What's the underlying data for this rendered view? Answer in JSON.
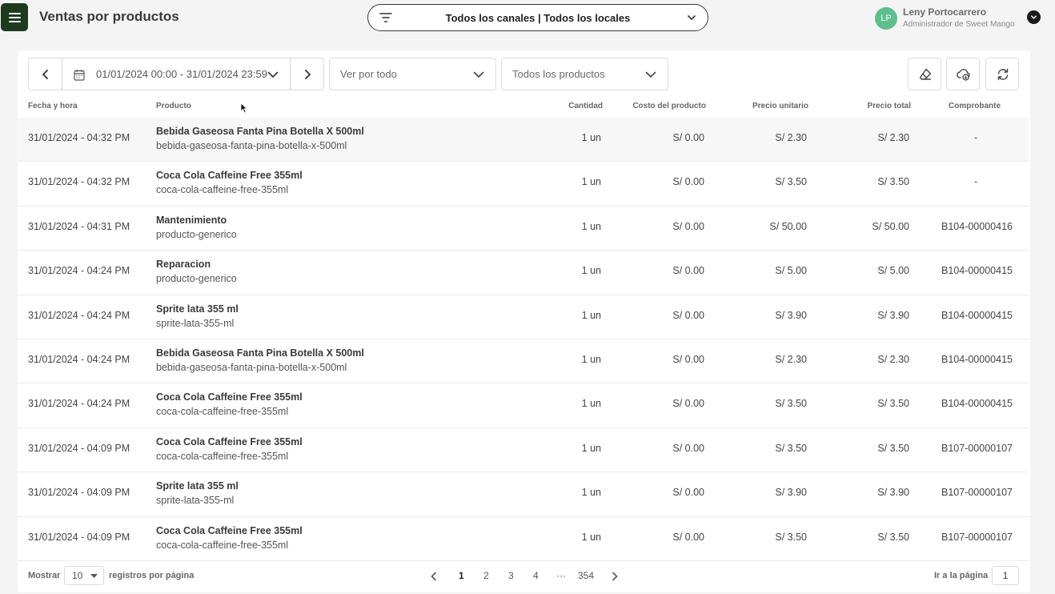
{
  "header": {
    "title": "Ventas por productos",
    "channel_filter": "Todos los canales | Todos los locales",
    "user": {
      "initials": "LP",
      "name": "Leny Portocarrero",
      "role": "Administrador de Sweet Mango"
    }
  },
  "toolbar": {
    "date_range": "01/01/2024 00:00 - 31/01/2024 23:59",
    "view_select": "Ver por todo",
    "product_select": "Todos los productos"
  },
  "table": {
    "columns": [
      "Fecha y hora",
      "Producto",
      "Cantidad",
      "Costo del producto",
      "Precio unitario",
      "Precio total",
      "Comprobante"
    ],
    "rows": [
      {
        "date": "31/01/2024 - 04:32 PM",
        "name": "Bebida Gaseosa Fanta Pina Botella X 500ml",
        "slug": "bebida-gaseosa-fanta-pina-botella-x-500ml",
        "qty": "1 un",
        "cost": "S/ 0.00",
        "unit": "S/ 2.30",
        "total": "S/ 2.30",
        "receipt": "-"
      },
      {
        "date": "31/01/2024 - 04:32 PM",
        "name": "Coca Cola Caffeine Free 355ml",
        "slug": "coca-cola-caffeine-free-355ml",
        "qty": "1 un",
        "cost": "S/ 0.00",
        "unit": "S/ 3.50",
        "total": "S/ 3.50",
        "receipt": "-"
      },
      {
        "date": "31/01/2024 - 04:31 PM",
        "name": "Mantenimiento",
        "slug": "producto-generico",
        "qty": "1 un",
        "cost": "S/ 0.00",
        "unit": "S/ 50.00",
        "total": "S/ 50.00",
        "receipt": "B104-00000416"
      },
      {
        "date": "31/01/2024 - 04:24 PM",
        "name": "Reparacion",
        "slug": "producto-generico",
        "qty": "1 un",
        "cost": "S/ 0.00",
        "unit": "S/ 5.00",
        "total": "S/ 5.00",
        "receipt": "B104-00000415"
      },
      {
        "date": "31/01/2024 - 04:24 PM",
        "name": "Sprite lata 355 ml",
        "slug": "sprite-lata-355-ml",
        "qty": "1 un",
        "cost": "S/ 0.00",
        "unit": "S/ 3.90",
        "total": "S/ 3.90",
        "receipt": "B104-00000415"
      },
      {
        "date": "31/01/2024 - 04:24 PM",
        "name": "Bebida Gaseosa Fanta Pina Botella X 500ml",
        "slug": "bebida-gaseosa-fanta-pina-botella-x-500ml",
        "qty": "1 un",
        "cost": "S/ 0.00",
        "unit": "S/ 2.30",
        "total": "S/ 2.30",
        "receipt": "B104-00000415"
      },
      {
        "date": "31/01/2024 - 04:24 PM",
        "name": "Coca Cola Caffeine Free 355ml",
        "slug": "coca-cola-caffeine-free-355ml",
        "qty": "1 un",
        "cost": "S/ 0.00",
        "unit": "S/ 3.50",
        "total": "S/ 3.50",
        "receipt": "B104-00000415"
      },
      {
        "date": "31/01/2024 - 04:09 PM",
        "name": "Coca Cola Caffeine Free 355ml",
        "slug": "coca-cola-caffeine-free-355ml",
        "qty": "1 un",
        "cost": "S/ 0.00",
        "unit": "S/ 3.50",
        "total": "S/ 3.50",
        "receipt": "B107-00000107"
      },
      {
        "date": "31/01/2024 - 04:09 PM",
        "name": "Sprite lata 355 ml",
        "slug": "sprite-lata-355-ml",
        "qty": "1 un",
        "cost": "S/ 0.00",
        "unit": "S/ 3.90",
        "total": "S/ 3.90",
        "receipt": "B107-00000107"
      },
      {
        "date": "31/01/2024 - 04:09 PM",
        "name": "Coca Cola Caffeine Free 355ml",
        "slug": "coca-cola-caffeine-free-355ml",
        "qty": "1 un",
        "cost": "S/ 0.00",
        "unit": "S/ 3.50",
        "total": "S/ 3.50",
        "receipt": "B107-00000107"
      }
    ]
  },
  "footer": {
    "show_label": "Mostrar",
    "per_page": "10",
    "per_page_label": "registros por página",
    "pages": [
      "1",
      "2",
      "3",
      "4",
      "···",
      "354"
    ],
    "goto_label": "Ir a la página",
    "goto_value": "1"
  }
}
